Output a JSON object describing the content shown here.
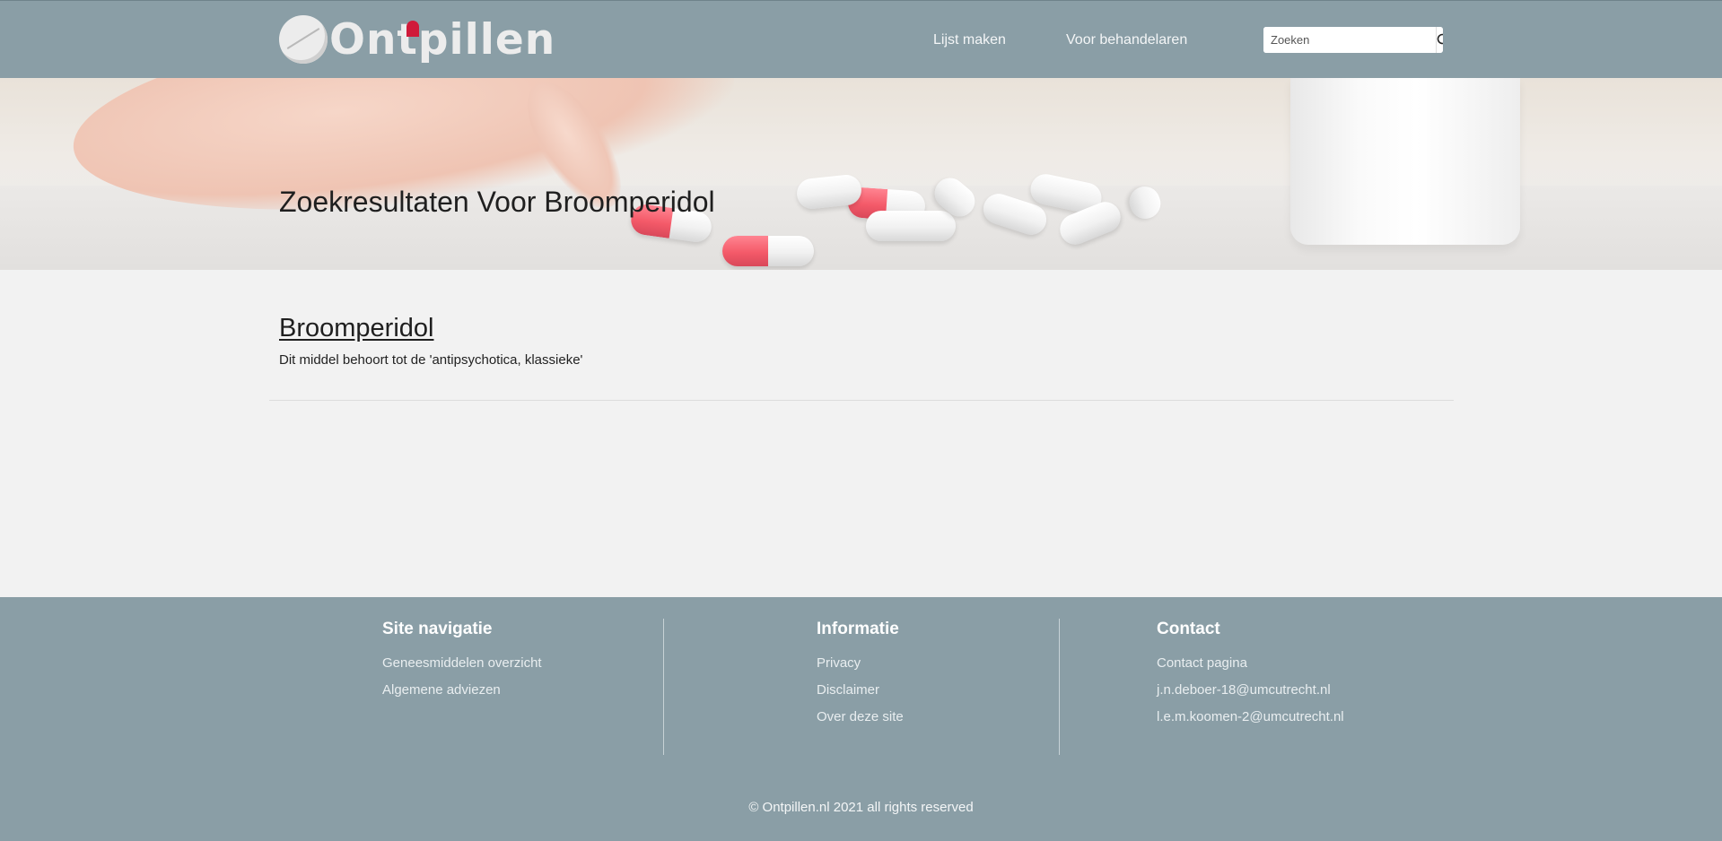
{
  "header": {
    "logo_text": "Ontpillen",
    "nav": [
      {
        "label": "Lijst maken"
      },
      {
        "label": "Voor behandelaren"
      }
    ],
    "search": {
      "placeholder": "Zoeken",
      "button_icon": "search-icon"
    }
  },
  "hero": {
    "title": "Zoekresultaten Voor Broomperidol"
  },
  "results": [
    {
      "title": "Broomperidol",
      "description": "Dit middel behoort tot de 'antipsychotica, klassieke'"
    }
  ],
  "footer": {
    "columns": [
      {
        "heading": "Site navigatie",
        "links": [
          "Geneesmiddelen overzicht",
          "Algemene adviezen"
        ]
      },
      {
        "heading": "Informatie",
        "links": [
          "Privacy",
          "Disclaimer",
          "Over deze site"
        ]
      },
      {
        "heading": "Contact",
        "links": [
          "Contact pagina",
          "j.n.deboer-18@umcutrecht.nl",
          "l.e.m.koomen-2@umcutrecht.nl"
        ]
      }
    ],
    "copyright": "© Ontpillen.nl 2021 all rights reserved"
  },
  "colors": {
    "header_bg": "#8a9ea6",
    "page_bg": "#f2f2f2",
    "logo_accent": "#d01a3a"
  }
}
